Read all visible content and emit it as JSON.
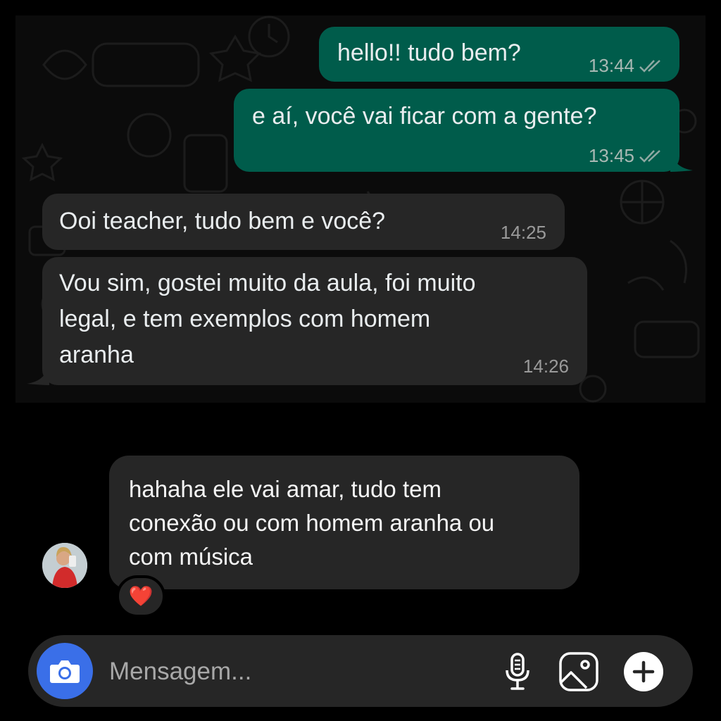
{
  "whatsapp": {
    "messages": [
      {
        "direction": "outgoing",
        "text": "hello!! tudo bem?",
        "time": "13:44",
        "status": "read"
      },
      {
        "direction": "outgoing",
        "text": "e aí, você vai ficar com a gente?",
        "time": "13:45",
        "status": "read"
      },
      {
        "direction": "incoming",
        "text": "Ooi teacher, tudo bem e você?",
        "time": "14:25"
      },
      {
        "direction": "incoming",
        "lines": [
          "Vou sim, gostei muito da aula, foi muito",
          "legal, e tem exemplos com homem",
          "aranha"
        ],
        "time": "14:26"
      }
    ],
    "colors": {
      "outgoing": "#005c4b",
      "incoming": "#262626",
      "read_tick": "#8fa9a3"
    }
  },
  "instagram": {
    "reply": {
      "lines": [
        "hahaha ele vai amar, tudo tem",
        "conexão ou com homem aranha ou",
        "com música"
      ],
      "reaction": "❤️"
    },
    "composer": {
      "placeholder": "Mensagem...",
      "icons": [
        "camera-icon",
        "microphone-icon",
        "gallery-icon",
        "plus-icon"
      ],
      "camera_color": "#3a6fe8"
    }
  }
}
